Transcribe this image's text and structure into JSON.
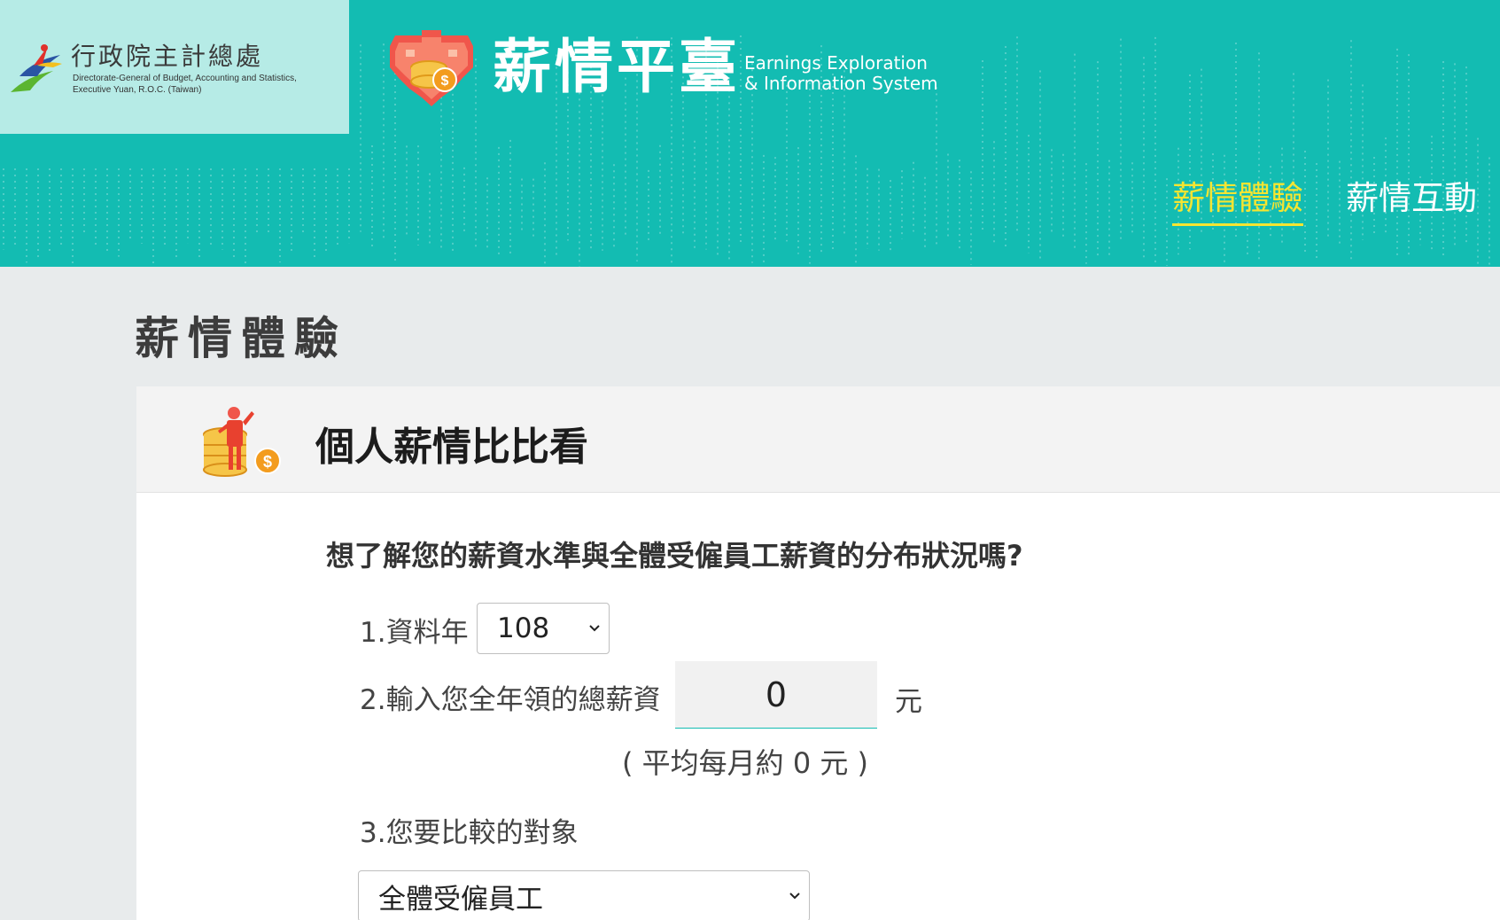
{
  "org": {
    "name_zh": "行政院主計總處",
    "name_en_line1": "Directorate-General of Budget, Accounting and Statistics,",
    "name_en_line2": "Executive Yuan, R.O.C. (Taiwan)"
  },
  "brand": {
    "title": "薪情平臺",
    "en_line1": "Earnings Exploration",
    "en_line2": "& Information System"
  },
  "nav": {
    "items": [
      {
        "label": "薪情體驗",
        "active": true
      },
      {
        "label": "薪情互動",
        "active": false
      }
    ]
  },
  "page": {
    "title": "薪情體驗"
  },
  "card": {
    "title": "個人薪情比比看",
    "question": "想了解您的薪資水準與全體受僱員工薪資的分布狀況嗎?",
    "year_label": "1.資料年",
    "year_value": "108",
    "salary_label": "2.輸入您全年領的總薪資",
    "salary_value": "0",
    "salary_unit": "元",
    "monthly_text": "( 平均每月約 0 元 )",
    "compare_label": "3.您要比較的對象",
    "compare_value": "全體受僱員工"
  },
  "colors": {
    "header_bg": "#13bcb2",
    "logo_bg": "#b6ebe6",
    "nav_active": "#f5e531",
    "page_bg": "#e8ebec"
  }
}
